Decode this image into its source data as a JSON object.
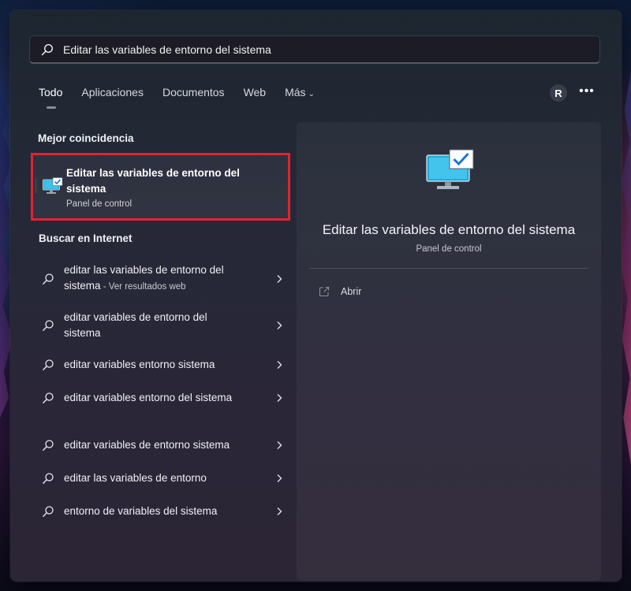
{
  "search": {
    "value": "Editar las variables de entorno del sistema",
    "icon": "search-icon"
  },
  "tabs": [
    {
      "label": "Todo",
      "active": true
    },
    {
      "label": "Aplicaciones"
    },
    {
      "label": "Documentos"
    },
    {
      "label": "Web"
    },
    {
      "label": "Más",
      "icon": "chevron-down-icon"
    }
  ],
  "account": {
    "initial": "R"
  },
  "more_menu": {
    "glyph": "•••"
  },
  "best_match": {
    "section_title": "Mejor coincidencia",
    "title": "Editar las variables de entorno del sistema",
    "subtitle": "Panel de control",
    "icon": "system-properties-icon",
    "highlight_color": "#e0242e"
  },
  "web_search": {
    "section_title": "Buscar en Internet",
    "items": [
      {
        "text": "editar las variables de entorno del sistema",
        "suffix": " - Ver resultados web"
      },
      {
        "text": "editar variables de entorno del sistema",
        "suffix": ""
      },
      {
        "text": "editar variables entorno sistema",
        "suffix": ""
      },
      {
        "text": "editar variables entorno del sistema",
        "suffix": ""
      },
      {
        "text": "editar variables de entorno sistema",
        "suffix": ""
      },
      {
        "text": "editar las variables de entorno",
        "suffix": ""
      },
      {
        "text": "entorno de variables del sistema",
        "suffix": ""
      }
    ]
  },
  "preview": {
    "title": "Editar las variables de entorno del sistema",
    "subtitle": "Panel de control",
    "actions": [
      {
        "label": "Abrir",
        "icon": "open-icon"
      }
    ]
  }
}
